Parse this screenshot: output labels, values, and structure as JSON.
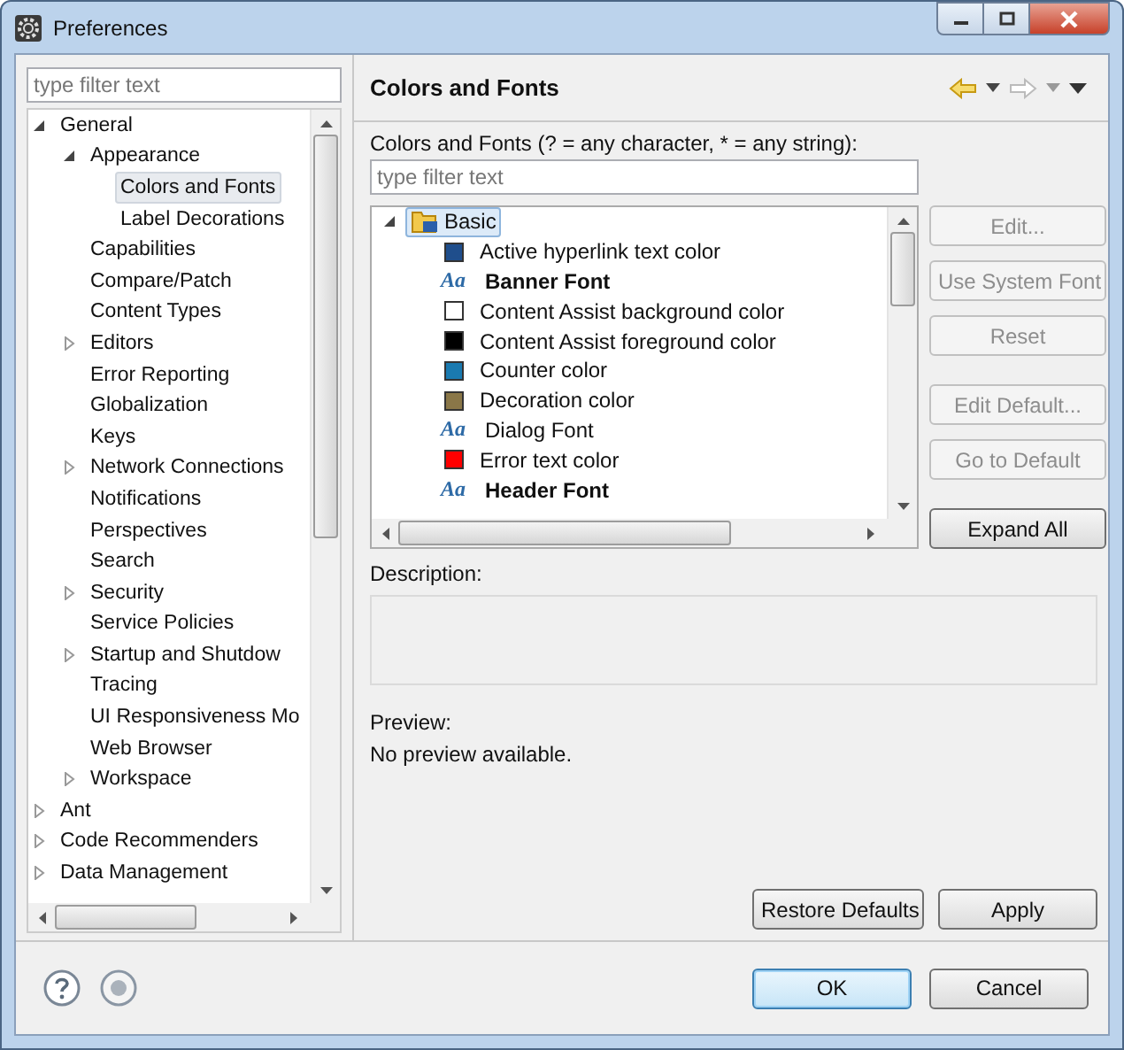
{
  "window": {
    "title": "Preferences"
  },
  "sidebar": {
    "filter": {
      "placeholder": "type filter text"
    },
    "tree": [
      {
        "label": "General",
        "expanded": true,
        "selected": false,
        "children": [
          {
            "label": "Appearance",
            "expanded": true,
            "selected": false,
            "children": [
              {
                "label": "Colors and Fonts",
                "selected": true
              },
              {
                "label": "Label Decorations",
                "selected": false
              }
            ]
          },
          {
            "label": "Capabilities",
            "selected": false
          },
          {
            "label": "Compare/Patch",
            "selected": false
          },
          {
            "label": "Content Types",
            "selected": false
          },
          {
            "label": "Editors",
            "expanded": false,
            "selected": false
          },
          {
            "label": "Error Reporting",
            "selected": false
          },
          {
            "label": "Globalization",
            "selected": false
          },
          {
            "label": "Keys",
            "selected": false
          },
          {
            "label": "Network Connections",
            "expanded": false,
            "selected": false
          },
          {
            "label": "Notifications",
            "selected": false
          },
          {
            "label": "Perspectives",
            "selected": false
          },
          {
            "label": "Search",
            "selected": false
          },
          {
            "label": "Security",
            "expanded": false,
            "selected": false
          },
          {
            "label": "Service Policies",
            "selected": false
          },
          {
            "label": "Startup and Shutdow",
            "expanded": false,
            "selected": false
          },
          {
            "label": "Tracing",
            "selected": false
          },
          {
            "label": "UI Responsiveness Mo",
            "selected": false
          },
          {
            "label": "Web Browser",
            "selected": false
          },
          {
            "label": "Workspace",
            "expanded": false,
            "selected": false
          }
        ]
      },
      {
        "label": "Ant",
        "expanded": false,
        "selected": false
      },
      {
        "label": "Code Recommenders",
        "expanded": false,
        "selected": false
      },
      {
        "label": "Data Management",
        "expanded": false,
        "selected": false
      }
    ]
  },
  "page": {
    "title": "Colors and Fonts",
    "nav": {
      "back_enabled": true,
      "forward_enabled": false
    },
    "filter_label": "Colors and Fonts (? = any character, * = any string):",
    "filter": {
      "placeholder": "type filter text"
    },
    "tree": [
      {
        "label": "Basic",
        "expanded": true,
        "selected": true,
        "children": [
          {
            "kind": "color",
            "label": "Active hyperlink text color",
            "color": "#1f4e8c"
          },
          {
            "kind": "font",
            "label": "Banner Font",
            "glyph": "Aa",
            "bold": true
          },
          {
            "kind": "color",
            "label": "Content Assist background color",
            "color": "#ffffff"
          },
          {
            "kind": "color",
            "label": "Content Assist foreground color",
            "color": "#000000"
          },
          {
            "kind": "color",
            "label": "Counter color",
            "color": "#1a7ab0"
          },
          {
            "kind": "color",
            "label": "Decoration color",
            "color": "#8a7748"
          },
          {
            "kind": "font",
            "label": "Dialog Font",
            "glyph": "Aa",
            "bold": false
          },
          {
            "kind": "color",
            "label": "Error text color",
            "color": "#ff0000"
          },
          {
            "kind": "font",
            "label": "Header Font",
            "glyph": "Aa",
            "bold": true
          }
        ]
      }
    ],
    "side_buttons": [
      {
        "label": "Edit...",
        "disabled": true
      },
      {
        "label": "Use System Font",
        "disabled": true
      },
      {
        "label": "Reset",
        "disabled": true
      },
      {
        "label": "Edit Default...",
        "disabled": true
      },
      {
        "label": "Go to Default",
        "disabled": true
      },
      {
        "label": "Expand All",
        "disabled": false
      }
    ],
    "description_label": "Description:",
    "preview_label": "Preview:",
    "preview_text": "No preview available.",
    "buttons": [
      "Restore Defaults",
      "Apply"
    ]
  },
  "footer": {
    "buttons": [
      {
        "label": "OK",
        "default": true
      },
      {
        "label": "Cancel",
        "default": false
      }
    ]
  }
}
